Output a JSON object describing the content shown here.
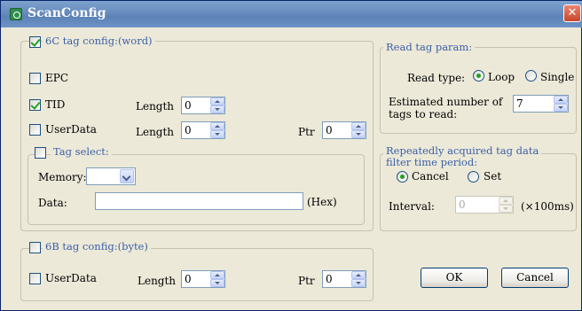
{
  "window": {
    "title": "ScanConfig",
    "close_glyph": "✕"
  },
  "tag6c": {
    "legend": "6C tag config:(word)",
    "epc_label": "EPC",
    "tid_label": "TID",
    "tid_length_label": "Length",
    "tid_length_value": "0",
    "userdata_label": "UserData",
    "userdata_length_label": "Length",
    "userdata_length_value": "0",
    "userdata_ptr_label": "Ptr",
    "userdata_ptr_value": "0",
    "checked": {
      "group": true,
      "epc": false,
      "tid": true,
      "userdata": false
    }
  },
  "tag_select": {
    "legend": "Tag select:",
    "memory_label": "Memory:",
    "memory_value": "",
    "data_label": "Data:",
    "data_value": "",
    "hex_label": "(Hex)",
    "checked": false
  },
  "tag6b": {
    "legend": "6B tag config:(byte)",
    "userdata_label": "UserData",
    "length_label": "Length",
    "length_value": "0",
    "ptr_label": "Ptr",
    "ptr_value": "0",
    "checked": {
      "group": false,
      "userdata": false
    }
  },
  "read_param": {
    "legend": "Read tag param:",
    "read_type_label": "Read type:",
    "loop_label": "Loop",
    "single_label": "Single",
    "selected": "Loop",
    "estimated_label_line1": "Estimated number of",
    "estimated_label_line2": "tags to read:",
    "estimated_value": "7"
  },
  "filter": {
    "legend_line1": "Repeatedly acquired tag data",
    "legend_line2": "filter time period:",
    "cancel_label": "Cancel",
    "set_label": "Set",
    "selected": "Cancel",
    "interval_label": "Interval:",
    "interval_value": "0",
    "interval_unit": "(×100ms)"
  },
  "buttons": {
    "ok": "OK",
    "cancel": "Cancel"
  },
  "colors": {
    "title_bar": "#6a8ebf",
    "dialog_bg": "#ece9d8",
    "legend_blue": "#3b5fa8",
    "check_green": "#21a121",
    "close_red": "#c9462c"
  }
}
